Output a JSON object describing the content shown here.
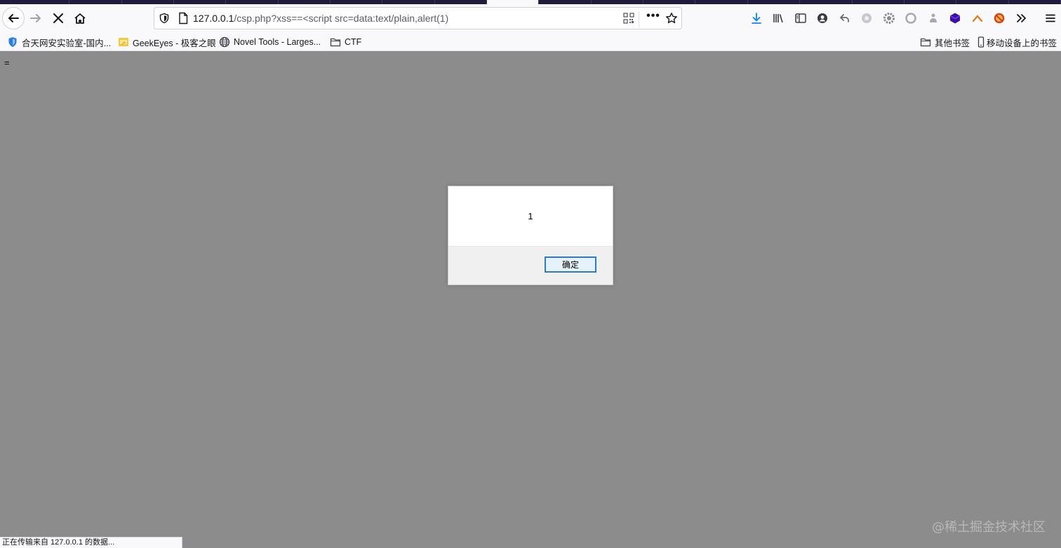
{
  "tabs": [
    {
      "label": ""
    },
    {
      "label": ""
    },
    {
      "label": ""
    },
    {
      "label": ""
    },
    {
      "label": ""
    },
    {
      "label": ""
    },
    {
      "label": ""
    },
    {
      "label": ""
    },
    {
      "label": ""
    },
    {
      "label": ""
    },
    {
      "label": ""
    },
    {
      "label": ""
    },
    {
      "label": ""
    },
    {
      "label": ""
    },
    {
      "label": ""
    },
    {
      "label": ""
    },
    {
      "label": ""
    },
    {
      "label": ""
    },
    {
      "label": ""
    },
    {
      "label": ""
    }
  ],
  "navbar": {
    "url_host": "127.0.0.1",
    "url_path": "/csp.php?xss==<script src=data:text/plain,alert(1)",
    "back_icon": "arrow-left-icon",
    "forward_icon": "arrow-right-icon",
    "stop_icon": "close-icon",
    "home_icon": "home-icon"
  },
  "toolbar_icons": [
    {
      "name": "download-icon",
      "color": "#0a84ff"
    },
    {
      "name": "library-icon",
      "color": "#3a3a44"
    },
    {
      "name": "sidebar-icon",
      "color": "#3a3a44"
    },
    {
      "name": "account-icon",
      "color": "#3a3a44"
    },
    {
      "name": "undo-icon",
      "color": "#6a6a72"
    },
    {
      "name": "extension-gray-icon",
      "color": "#a8a8b0"
    },
    {
      "name": "gear-extension-icon",
      "color": "#8a8a92"
    },
    {
      "name": "circle-extension-icon",
      "color": "#a8a8b0"
    },
    {
      "name": "puzzle-extension-icon",
      "color": "#a8a8b0"
    },
    {
      "name": "hexagon-extension-icon",
      "color": "#3b0fa8"
    },
    {
      "name": "caret-extension-icon",
      "color": "#e0781c"
    },
    {
      "name": "blocked-extension-icon",
      "color": "#d23a1e"
    },
    {
      "name": "overflow-chevron-icon",
      "color": "#15141a"
    },
    {
      "name": "menu-icon",
      "color": "#15141a"
    }
  ],
  "bookmarks": {
    "left": [
      {
        "label": "合天网安实验室-国内...",
        "icon": "shield-bookmark-icon"
      },
      {
        "label": "GeekEyes - 极客之眼",
        "icon": "folder-yellow-icon"
      },
      {
        "label": "Novel Tools - Larges...",
        "icon": "globe-icon"
      },
      {
        "label": "CTF",
        "icon": "folder-icon"
      }
    ],
    "right": [
      {
        "label": "其他书签",
        "icon": "folder-icon"
      },
      {
        "label": "移动设备上的书签",
        "icon": "mobile-icon"
      }
    ]
  },
  "page": {
    "text": "="
  },
  "alert": {
    "message": "1",
    "ok_label": "确定"
  },
  "status": {
    "text": "正在传输来自 127.0.0.1 的数据..."
  },
  "watermark": {
    "text": "@稀土掘金技术社区"
  }
}
